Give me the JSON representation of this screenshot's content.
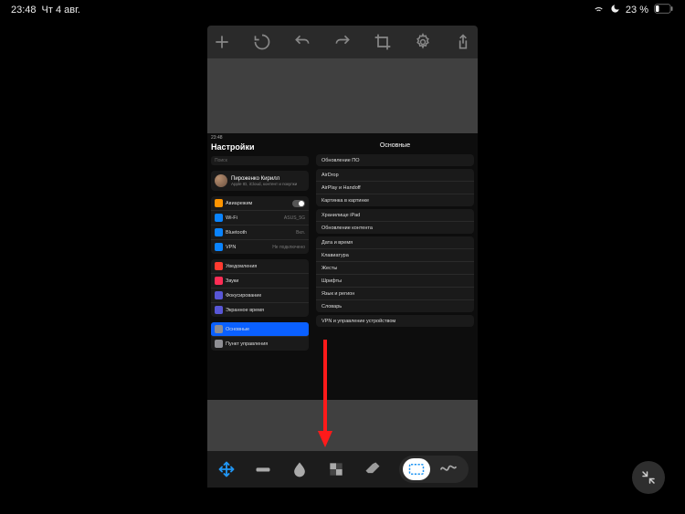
{
  "status": {
    "time": "23:48",
    "date": "Чт 4 авг.",
    "battery": "23 %"
  },
  "inner": {
    "time": "23:48",
    "sidebar": {
      "title": "Настройки",
      "search": "Поиск",
      "profile": {
        "name": "Пироженко Кирилл",
        "sub": "Apple ID, iCloud, контент и покупки"
      },
      "group1": [
        {
          "label": "Авиарежим",
          "toggle": true
        },
        {
          "label": "Wi-Fi",
          "value": "ASUS_5G"
        },
        {
          "label": "Bluetooth",
          "value": "Вкл."
        },
        {
          "label": "VPN",
          "value": "Не подключено"
        }
      ],
      "group2": [
        {
          "label": "Уведомления"
        },
        {
          "label": "Звуки"
        },
        {
          "label": "Фокусирование"
        },
        {
          "label": "Экранное время"
        }
      ],
      "group3": [
        {
          "label": "Основные",
          "selected": true
        },
        {
          "label": "Пункт управления"
        }
      ],
      "colors": [
        "#ff9500",
        "#0a84ff",
        "#0a84ff",
        "#0a84ff",
        "#ff3b30",
        "#ff2d55",
        "#5856d6",
        "#5856d6",
        "#8e8e93",
        "#8e8e93"
      ]
    },
    "main": {
      "title": "Основные",
      "blocks": [
        [
          "Обновление ПО"
        ],
        [
          "AirDrop",
          "AirPlay и Handoff",
          "Картинка в картинке"
        ],
        [
          "Хранилище iPad",
          "Обновление контента"
        ],
        [
          "Дата и время",
          "Клавиатура",
          "Жесты",
          "Шрифты",
          "Язык и регион",
          "Словарь"
        ],
        [
          "VPN и управление устройством"
        ]
      ]
    }
  }
}
